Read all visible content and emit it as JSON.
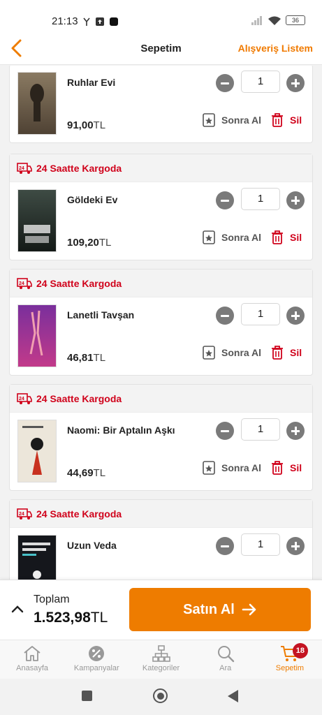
{
  "status_bar": {
    "time": "21:13",
    "battery": "36"
  },
  "header": {
    "title": "Sepetim",
    "list_link": "Alışveriş Listem"
  },
  "cargo_label": "24 Saatte Kargoda",
  "cargo_badge": "24",
  "actions": {
    "later": "Sonra Al",
    "delete": "Sil"
  },
  "currency": "TL",
  "items": [
    {
      "title": "Ruhlar Evi",
      "price": "91,00",
      "qty": "1",
      "cover_text": "Allende Ruhlar Evi",
      "cover_color": "#6b5a48"
    },
    {
      "title": "Göldeki Ev",
      "price": "109,20",
      "qty": "1",
      "cover_text": "GÖLDEKİ EV",
      "cover_color": "#24302c"
    },
    {
      "title": "Lanetli Tavşan",
      "price": "46,81",
      "qty": "1",
      "cover_text": "Lanetli Tavşan",
      "cover_color": "#6f2a8f"
    },
    {
      "title": "Naomi: Bir Aptalın Aşkı",
      "price": "44,69",
      "qty": "1",
      "cover_text": "Naomi",
      "cover_color": "#e8e2d6"
    },
    {
      "title": "Uzun Veda",
      "price": "",
      "qty": "1",
      "cover_text": "RAYMOND CHANDLER UZUN VEDA",
      "cover_color": "#15171c"
    }
  ],
  "footer": {
    "total_label": "Toplam",
    "total_value": "1.523,98",
    "buy_label": "Satın Al"
  },
  "tabs": [
    {
      "label": "Anasayfa",
      "icon": "home-icon"
    },
    {
      "label": "Kampanyalar",
      "icon": "percent-badge-icon"
    },
    {
      "label": "Kategoriler",
      "icon": "hierarchy-icon"
    },
    {
      "label": "Ara",
      "icon": "search-icon"
    },
    {
      "label": "Sepetim",
      "icon": "cart-icon",
      "badge": "18",
      "active": true
    }
  ],
  "colors": {
    "accent": "#ee7c00",
    "danger": "#d0021b",
    "badge": "#c41422"
  }
}
